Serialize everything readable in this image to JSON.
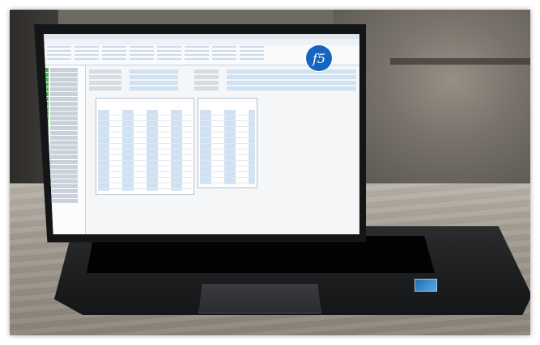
{
  "logo": {
    "text": "f5",
    "color": "#1565c0"
  },
  "laptop": {
    "screen_background": "#f4f6f8",
    "sticker_color": "#1f6fb3"
  }
}
